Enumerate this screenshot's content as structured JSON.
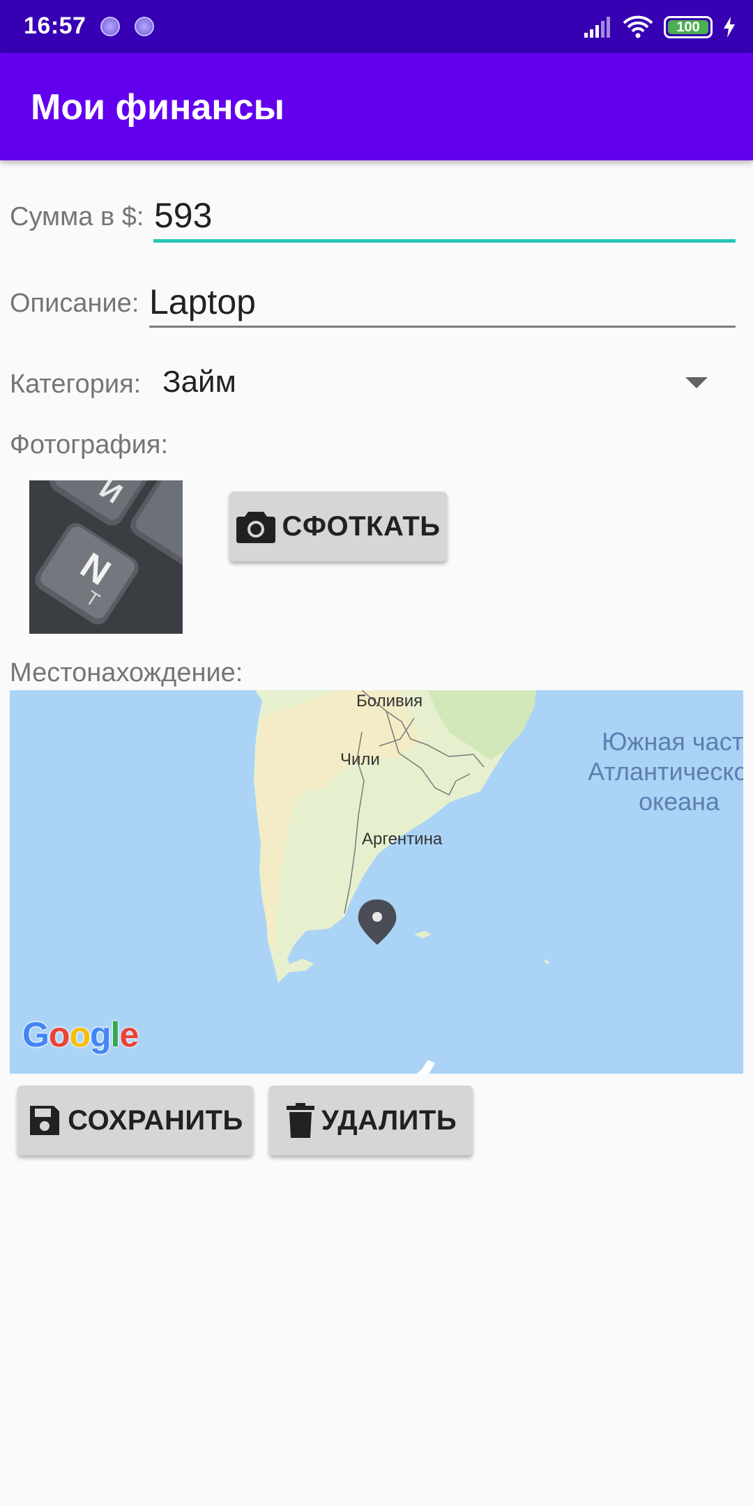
{
  "status_bar": {
    "time": "16:57",
    "battery": "100"
  },
  "app_bar": {
    "title": "Мои финансы"
  },
  "form": {
    "amount_label": "Сумма в $:",
    "amount_value": "593",
    "description_label": "Описание:",
    "description_value": "Laptop",
    "category_label": "Категория:",
    "category_value": "Займ",
    "photo_label": "Фотография:",
    "take_photo_button": "СФОТКАТЬ",
    "location_label": "Местонахождение:"
  },
  "map": {
    "labels": {
      "bolivia": "Боливия",
      "chile": "Чили",
      "argentina": "Аргентина",
      "ocean_line1": "Южная часть",
      "ocean_line2": "Атлантического",
      "ocean_line3": "океана"
    },
    "logo": "Google",
    "marker_icon": "map-marker-icon"
  },
  "actions": {
    "save_button": "СОХРАНИТЬ",
    "delete_button": "УДАЛИТЬ"
  },
  "colors": {
    "status_bar": "#3700b3",
    "app_bar": "#6200ee",
    "focus_underline": "#26c6b8",
    "button_bg": "#d6d6d6",
    "map_water": "#aad3f6"
  }
}
